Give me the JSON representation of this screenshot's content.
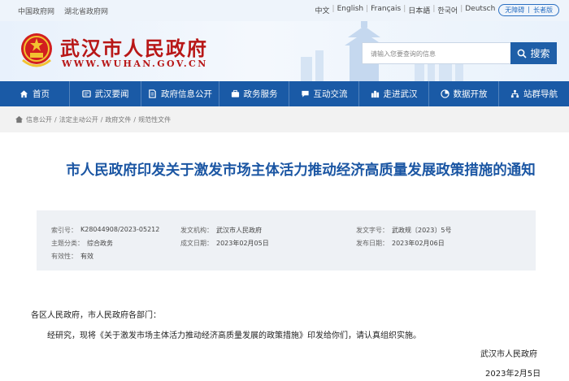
{
  "topbar": {
    "links": [
      "中国政府网",
      "湖北省政府网"
    ],
    "languages": [
      "中文",
      "English",
      "Français",
      "日本語",
      "한국어",
      "Deutsch"
    ],
    "accessibility": "无障碍",
    "elderly": "长者版"
  },
  "header": {
    "site_name": "武汉市人民政府",
    "site_url": "WWW.WUHAN.GOV.CN",
    "search_placeholder": "请输入您要查询的信息",
    "search_label": "搜索"
  },
  "nav": [
    {
      "label": "首页",
      "icon": "home-icon"
    },
    {
      "label": "武汉要闻",
      "icon": "news-icon"
    },
    {
      "label": "政府信息公开",
      "icon": "document-icon"
    },
    {
      "label": "政务服务",
      "icon": "briefcase-icon"
    },
    {
      "label": "互动交流",
      "icon": "chat-icon"
    },
    {
      "label": "走进武汉",
      "icon": "city-icon"
    },
    {
      "label": "数据开放",
      "icon": "chart-icon"
    },
    {
      "label": "站群导航",
      "icon": "sitemap-icon"
    }
  ],
  "breadcrumb": [
    "信息公开",
    "法定主动公开",
    "政府文件",
    "规范性文件"
  ],
  "article": {
    "title": "市人民政府印发关于激发市场主体活力推动经济高质量发展政策措施的通知",
    "meta": {
      "index_label": "索引号：",
      "index_value": "K28044908/2023-05212",
      "issuer_label": "发文机构：",
      "issuer_value": "武汉市人民政府",
      "doc_no_label": "发文字号：",
      "doc_no_value": "武政规〔2023〕5号",
      "category_label": "主题分类：",
      "category_value": "综合政务",
      "date_label": "成文日期：",
      "date_value": "2023年02月05日",
      "publish_label": "发布日期：",
      "publish_value": "2023年02月06日",
      "validity_label": "有效性：",
      "validity_value": "有效"
    },
    "salutation": "各区人民政府，市人民政府各部门：",
    "paragraph": "经研究，现将《关于激发市场主体活力推动经济高质量发展的政策措施》印发给你们，请认真组织实施。",
    "signer": "武汉市人民政府",
    "sign_date": "2023年2月5日"
  },
  "colors": {
    "brand_red": "#b81717",
    "nav_blue": "#1a5aa6",
    "title_blue": "#1b56a3"
  }
}
